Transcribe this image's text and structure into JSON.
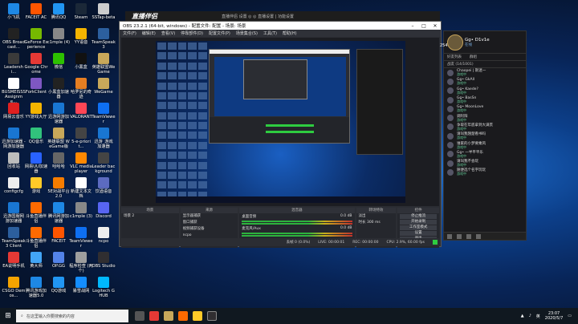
{
  "desktop_icons": [
    {
      "label": "小飞机",
      "color": "#1e88e5"
    },
    {
      "label": "FACEIT AC",
      "color": "#ff5500"
    },
    {
      "label": "腾讯QQ",
      "color": "#2196f3"
    },
    {
      "label": "Steam",
      "color": "#1b2838"
    },
    {
      "label": "SSTap-beta",
      "color": "#cccccc"
    },
    {
      "label": "OBS Broadcast...",
      "color": "#222222"
    },
    {
      "label": "GeForce Experience",
      "color": "#76b900"
    },
    {
      "label": "c1mple (4)",
      "color": "#888888"
    },
    {
      "label": "YY语音",
      "color": "#f5b400"
    },
    {
      "label": "TeamSpeak 3",
      "color": "#2c5f9e"
    },
    {
      "label": "Leadershi...",
      "color": "#3a3a3a"
    },
    {
      "label": "Google Chrome",
      "color": "#e53935"
    },
    {
      "label": "微信",
      "color": "#2dc100"
    },
    {
      "label": "小黑盒",
      "color": "#111111"
    },
    {
      "label": "英雄联盟WeGame",
      "color": "#c8a85a"
    },
    {
      "label": "BUSMEISSS Assignme...",
      "color": "#ffffff"
    },
    {
      "label": "ForkClient",
      "color": "#7e57c2"
    },
    {
      "label": "小黑盒加速器",
      "color": "#222222"
    },
    {
      "label": "哈罗尼的奇迹",
      "color": "#e67e22"
    },
    {
      "label": "WeGame",
      "color": "#c8a85a"
    },
    {
      "label": "网易云音乐",
      "color": "#e02020"
    },
    {
      "label": "YY游戏大厅",
      "color": "#f5b400"
    },
    {
      "label": "迅游网游加速器",
      "color": "#1976d2"
    },
    {
      "label": "VALORANT",
      "color": "#ff4655"
    },
    {
      "label": "TeamViewer",
      "color": "#0e6ff2"
    },
    {
      "label": "迅游加速器 - 网游加速器",
      "color": "#1976d2"
    },
    {
      "label": "QQ音乐",
      "color": "#31c27c"
    },
    {
      "label": "英雄联盟 WeGame版",
      "color": "#c8a85a"
    },
    {
      "label": "5-e-priorit...",
      "color": "#444444"
    },
    {
      "label": "迅游_游戏 加速器",
      "color": "#1976d2"
    },
    {
      "label": "回收站",
      "color": "#bdbdbd"
    },
    {
      "label": "网易UU加速器",
      "color": "#2962ff"
    },
    {
      "label": "哈哈哈",
      "color": "#666666"
    },
    {
      "label": "VLC media player",
      "color": "#ff8800"
    },
    {
      "label": "Leader background",
      "color": "#444444"
    },
    {
      "label": "configcfg",
      "color": "#eeeeee"
    },
    {
      "label": "游戏",
      "color": "#ffca28"
    },
    {
      "label": "5E对战平台 2.0",
      "color": "#f57c00"
    },
    {
      "label": "新建文本文档",
      "color": "#ffffff"
    },
    {
      "label": "饮酒语音",
      "color": "#5c6bc0"
    },
    {
      "label": "迅游国服网游加速器",
      "color": "#1976d2"
    },
    {
      "label": "斗鱼直播伴侣",
      "color": "#ff6a00"
    },
    {
      "label": "腾讯网游加速器",
      "color": "#1e88e5"
    },
    {
      "label": "c1mple (3)",
      "color": "#888888"
    },
    {
      "label": "Discord",
      "color": "#5865f2"
    },
    {
      "label": "TeamSpeak 3 Client",
      "color": "#2c5f9e"
    },
    {
      "label": "斗鱼直播伴侣",
      "color": "#ff6a00"
    },
    {
      "label": "FACEIT",
      "color": "#ff5500"
    },
    {
      "label": "TeamViewer",
      "color": "#0e6ff2"
    },
    {
      "label": "ncpo",
      "color": "#eeeeee"
    },
    {
      "label": "EA说明手机",
      "color": "#e53935"
    },
    {
      "label": "黄大师",
      "color": "#42a5f5"
    },
    {
      "label": "OP.GG",
      "color": "#5383e8"
    },
    {
      "label": "程序检查 (两个)",
      "color": "#9e9e9e"
    },
    {
      "label": "OBS Studio",
      "color": "#302e31"
    },
    {
      "label": "CSGO Demos...",
      "color": "#f4a300"
    },
    {
      "label": "腾讯游戏加速器5.0",
      "color": "#1e88e5"
    },
    {
      "label": "QQ游戏",
      "color": "#2196f3"
    },
    {
      "label": "暴雪战网",
      "color": "#148eff"
    },
    {
      "label": "Logitech G HUB",
      "color": "#00b8fc"
    }
  ],
  "ad_banner": {
    "logo": "直播伴侣",
    "title": "直播伴侣  设置  ◎  ◎  直播设置 | 功能设置"
  },
  "obs": {
    "title": "OBS 23.2.1 (64-bit, windows) - 配置文件: 配置 - 场景: 场景",
    "menu": [
      "文件(F)",
      "编辑(E)",
      "查看(V)",
      "停靠部件(D)",
      "配置文件(P)",
      "场景集合(S)",
      "工具(T)",
      "帮助(H)"
    ],
    "docks": {
      "scenes": {
        "header": "场景",
        "items": [
          "场景 2"
        ]
      },
      "sources": {
        "header": "来源",
        "items": [
          "显示器捕获",
          "窗口捕获",
          "视频捕获设备",
          "ncpo"
        ]
      },
      "mixer": {
        "header": "混音器",
        "rows": [
          {
            "name": "桌面音频",
            "db": "0.0 dB"
          },
          {
            "name": "麦克风/Aux",
            "db": "0.0 dB"
          }
        ]
      },
      "transitions": {
        "header": "转场特效",
        "type": "淡出",
        "duration_label": "时长",
        "duration": "300 ms"
      },
      "controls": {
        "header": "控件",
        "buttons": [
          "停止推流",
          "开始录制",
          "工作室模式",
          "设置",
          "退出"
        ]
      }
    },
    "status": {
      "dropped": "丢帧 0 (0.0%)",
      "live": "LIVE: 00:00:01",
      "rec": "REC: 00:00:00",
      "cpu": "CPU: 2.9%, 60.00 fps"
    }
  },
  "chat": {
    "user_name": "Gg• D1v1e",
    "user_status": "在线",
    "side_number": "254",
    "tabs": [
      "好友列表",
      "群组"
    ],
    "group": "战友 (14/1001)",
    "friends": [
      {
        "name": "Chaopei | 斯迷一",
        "status": "游戏中"
      },
      {
        "name": "Gg• GkAll",
        "status": "游戏中"
      },
      {
        "name": "Gg• Kaede?",
        "status": "游戏中"
      },
      {
        "name": "Gg• BasSn",
        "status": "游戏中"
      },
      {
        "name": "Gg• MoonLove",
        "status": "游戏中"
      },
      {
        "name": "调阿阳",
        "status": "游戏中"
      },
      {
        "name": "争取在年底拿到大满贯",
        "status": "游戏中"
      },
      {
        "name": "请叫我翘楚看书吗",
        "status": "游戏中"
      },
      {
        "name": "谁家的小梦要乘风",
        "status": "游戏中"
      },
      {
        "name": "Gg• 一半平平乐",
        "status": "游戏中"
      },
      {
        "name": "请叫我不会玩",
        "status": "游戏中"
      },
      {
        "name": "随便选个名字玩玩",
        "status": "游戏中"
      }
    ]
  },
  "taskbar": {
    "search_placeholder": "在这里输入你要搜索的内容",
    "time": "23:07",
    "date": "2020/5/7",
    "lang": "英"
  }
}
